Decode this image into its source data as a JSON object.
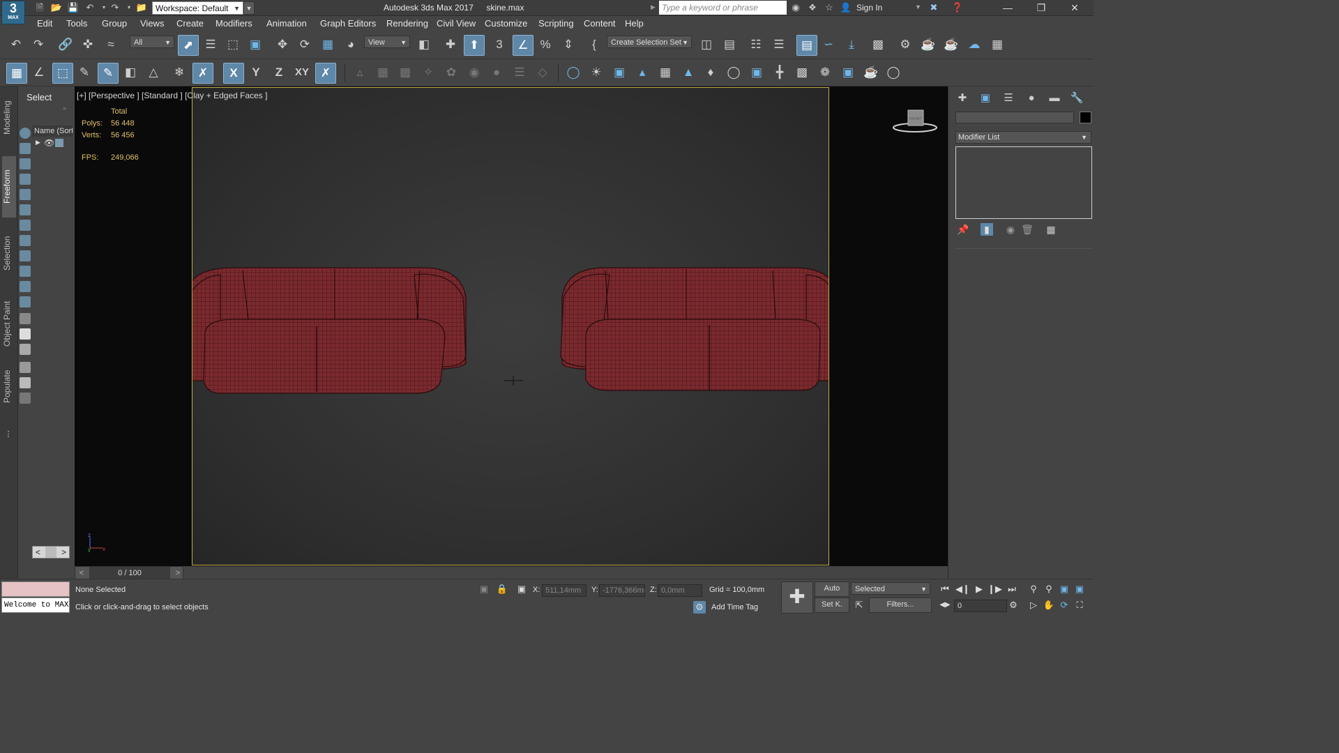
{
  "title_bar": {
    "logo_text": "3",
    "logo_sub": "MAX",
    "workspace": "Workspace: Default",
    "app_name": "Autodesk 3ds Max 2017",
    "file_name": "skine.max",
    "search_placeholder": "Type a keyword or phrase",
    "sign_in": "Sign In"
  },
  "menu": [
    "Edit",
    "Tools",
    "Group",
    "Views",
    "Create",
    "Modifiers",
    "Animation",
    "Graph Editors",
    "Rendering",
    "Civil View",
    "Customize",
    "Scripting",
    "Content",
    "Help"
  ],
  "toolbar": {
    "selection_filter": "All",
    "ref_coord": "View",
    "create_selection_set": "Create Selection Set"
  },
  "axis_constraints": [
    "X",
    "Y",
    "Z",
    "XY"
  ],
  "ribbon_tabs": [
    "Modeling",
    "Freeform",
    "Selection",
    "Object Paint",
    "Populate"
  ],
  "scene_explorer": {
    "title": "Select",
    "column_header": "Name (Sorted Ascending)"
  },
  "viewport": {
    "label": "[+] [Perspective ] [Standard ] [Clay + Edged Faces ]",
    "stats_header": "Total",
    "polys_label": "Polys:",
    "polys_value": "56 448",
    "verts_label": "Verts:",
    "verts_value": "56 456",
    "fps_label": "FPS:",
    "fps_value": "249,066",
    "viewcube_label": "FRONT",
    "sofa_color": "#7a2a2e",
    "wire_color": "#3a0d10"
  },
  "command_panel": {
    "modifier_list": "Modifier List"
  },
  "time_slider": {
    "label": "0 / 100"
  },
  "status": {
    "selection": "None Selected",
    "prompt": "Click or click-and-drag to select objects",
    "maxscript_text": "Welcome to MAXScript.",
    "x_label": "X:",
    "x_value": "511,14mm",
    "y_label": "Y:",
    "y_value": "-1776,366mm",
    "z_label": "Z:",
    "z_value": "0,0mm",
    "grid": "Grid = 100,0mm",
    "add_time_tag": "Add Time Tag",
    "auto_key": "Auto",
    "set_key": "Set K.",
    "key_mode": "Selected",
    "filters": "Filters...",
    "frame": "0"
  }
}
